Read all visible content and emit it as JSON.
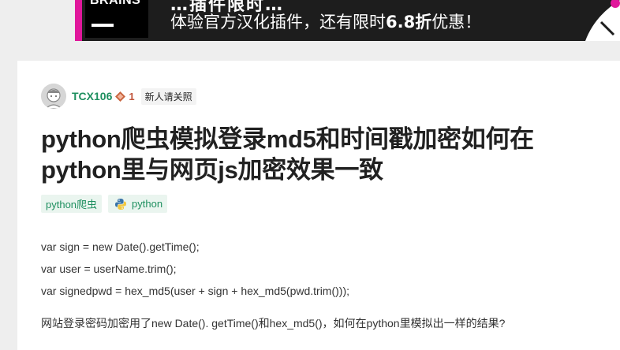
{
  "ad": {
    "logo_text": "BRAINS",
    "headline_cut": "…插件限时…",
    "text_before": "体验官方汉化插件，还有限时",
    "text_bold": "6.8折",
    "text_after": "优惠！",
    "accent_color": "#e0179b"
  },
  "author": {
    "name": "TCX106",
    "reputation_icon": "diamond-icon",
    "reputation": "1",
    "badge": "新人请关照"
  },
  "question": {
    "title": "python爬虫模拟登录md5和时间戳加密如何在python里与网页js加密效果一致",
    "tags": [
      {
        "label": "python爬虫",
        "icon": ""
      },
      {
        "label": "python",
        "icon": "python-icon"
      }
    ],
    "code_lines": [
      "var sign = new Date().getTime();",
      "var user = userName.trim();",
      "var signedpwd = hex_md5(user + sign + hex_md5(pwd.trim()));"
    ],
    "body": "网站登录密码加密用了new Date(). getTime()和hex_md5()，如何在python里模拟出一样的结果?"
  },
  "colors": {
    "accent_green": "#1e8f5f",
    "tag_bg": "#eaf5ef",
    "page_bg": "#eeeeee"
  }
}
